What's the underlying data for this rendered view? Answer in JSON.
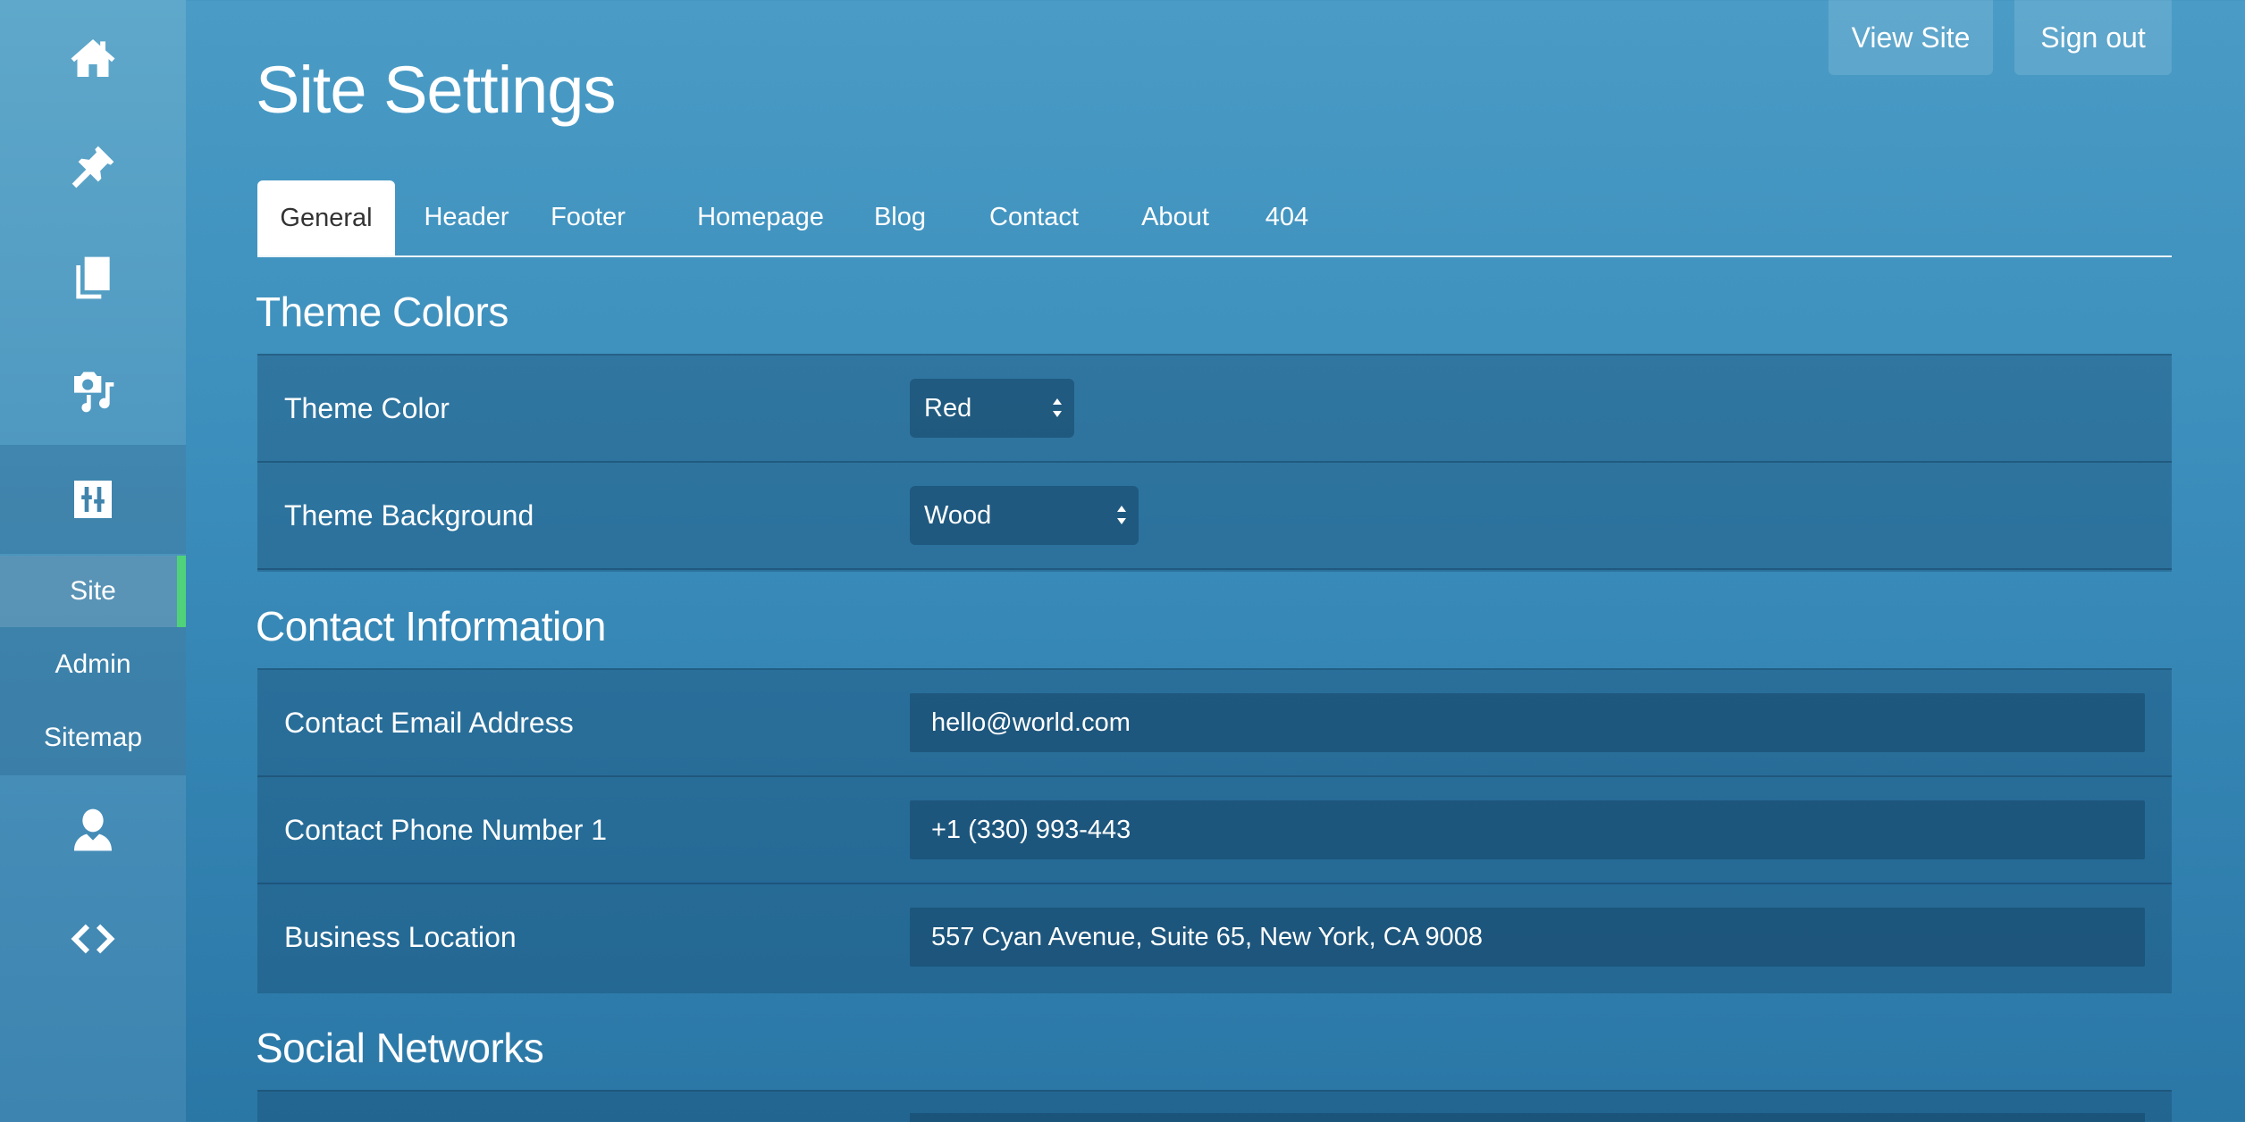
{
  "sidebar": {
    "icons": [
      "home-icon",
      "pin-icon",
      "pages-icon",
      "media-icon",
      "settings-icon",
      "user-icon",
      "code-icon"
    ],
    "submenu": [
      {
        "label": "Site",
        "selected": true
      },
      {
        "label": "Admin",
        "selected": false
      },
      {
        "label": "Sitemap",
        "selected": false
      }
    ],
    "active_indicator_color": "#4fd27a"
  },
  "header": {
    "title": "Site Settings",
    "view_site_label": "View Site",
    "sign_out_label": "Sign out"
  },
  "tabs": [
    {
      "label": "General",
      "active": true
    },
    {
      "label": "Header",
      "active": false
    },
    {
      "label": "Footer",
      "active": false
    },
    {
      "label": "Homepage",
      "active": false
    },
    {
      "label": "Blog",
      "active": false
    },
    {
      "label": "Contact",
      "active": false
    },
    {
      "label": "About",
      "active": false
    },
    {
      "label": "404",
      "active": false
    }
  ],
  "sections": {
    "theme_colors": {
      "heading": "Theme Colors",
      "theme_color": {
        "label": "Theme Color",
        "value": "Red"
      },
      "theme_background": {
        "label": "Theme Background",
        "value": "Wood"
      }
    },
    "contact_information": {
      "heading": "Contact Information",
      "email": {
        "label": "Contact Email Address",
        "value": "hello@world.com"
      },
      "phone": {
        "label": "Contact Phone Number 1",
        "value": "+1 (330) 993-443"
      },
      "location": {
        "label": "Business Location",
        "value": "557 Cyan Avenue, Suite 65, New York, CA 9008"
      }
    },
    "social_networks": {
      "heading": "Social Networks"
    }
  }
}
